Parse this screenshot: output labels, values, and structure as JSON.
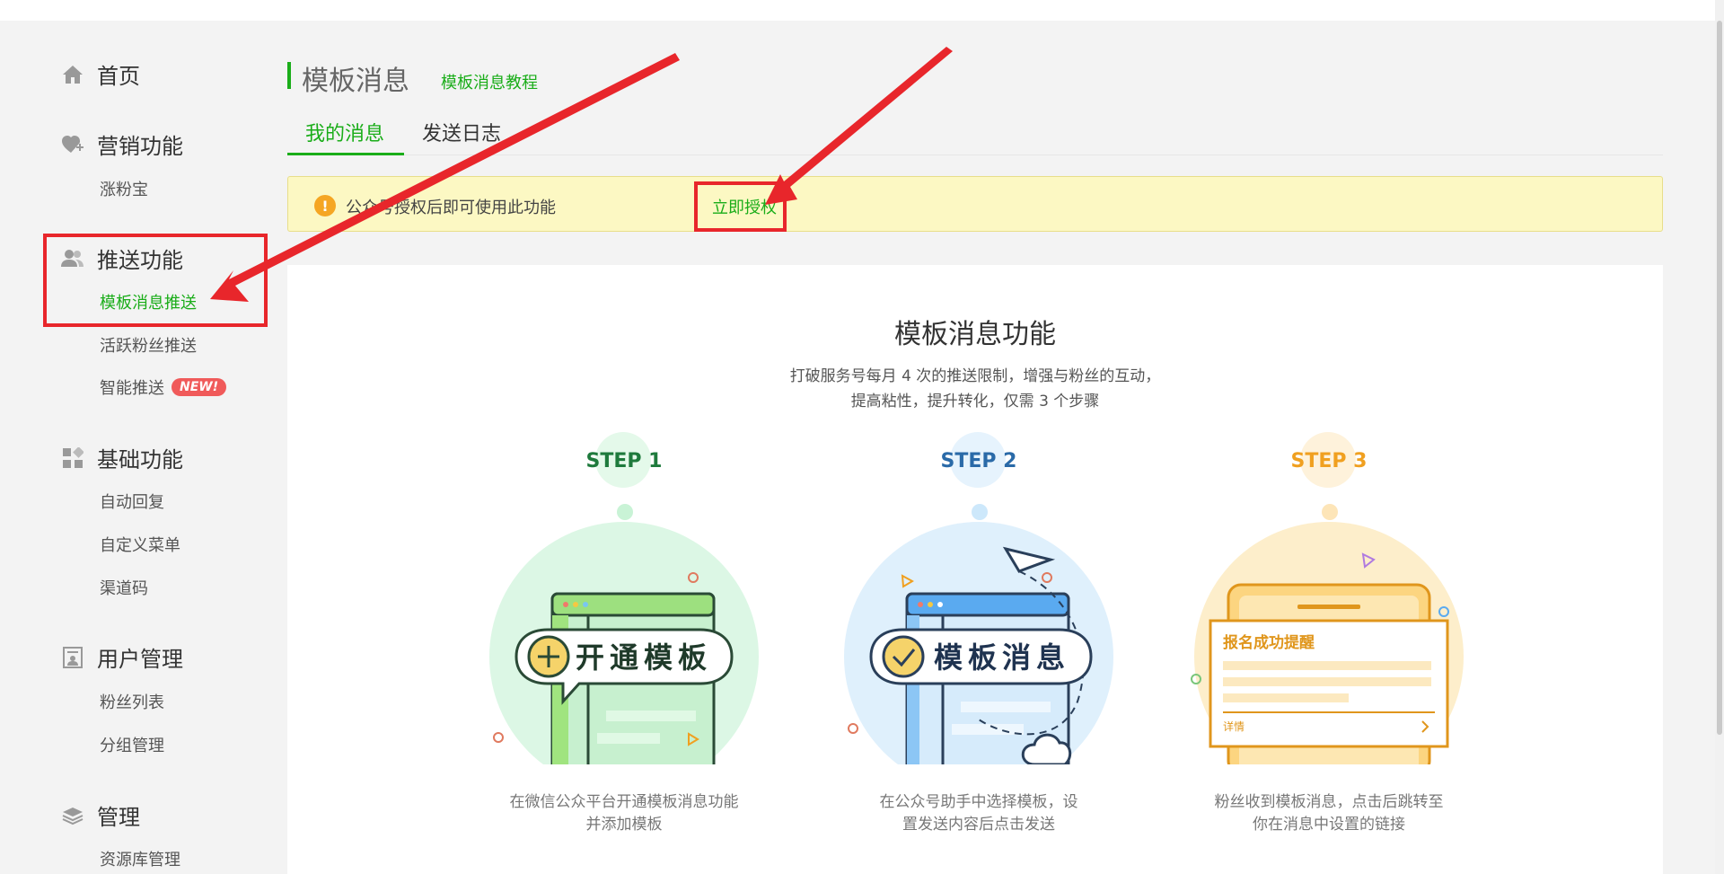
{
  "sidebar": {
    "home": "首页",
    "marketing": {
      "label": "营销功能",
      "items": [
        "涨粉宝"
      ]
    },
    "push": {
      "label": "推送功能",
      "items": [
        "模板消息推送",
        "活跃粉丝推送",
        "智能推送"
      ],
      "new_badge": "NEW!"
    },
    "basic": {
      "label": "基础功能",
      "items": [
        "自动回复",
        "自定义菜单",
        "渠道码"
      ]
    },
    "users": {
      "label": "用户管理",
      "items": [
        "粉丝列表",
        "分组管理"
      ]
    },
    "manage": {
      "label": "管理",
      "items": [
        "资源库管理"
      ]
    }
  },
  "main": {
    "title": "模板消息",
    "tutorial_link": "模板消息教程",
    "tabs": [
      "我的消息",
      "发送日志"
    ],
    "notice": {
      "text": "公众号授权后即可使用此功能",
      "action": "立即授权"
    },
    "feature": {
      "title": "模板消息功能",
      "desc_line1": "打破服务号每月 4 次的推送限制，增强与粉丝的互动，",
      "desc_line2": "提高粘性，提升转化，仅需 3 个步骤"
    },
    "steps": [
      {
        "label": "STEP 1",
        "art_text": "开通模板",
        "caption_line1": "在微信公众平台开通模板消息功能",
        "caption_line2": "并添加模板"
      },
      {
        "label": "STEP 2",
        "art_text": "模板消息",
        "caption_line1": "在公众号助手中选择模板，设",
        "caption_line2": "置发送内容后点击发送"
      },
      {
        "label": "STEP 3",
        "card_title": "报名成功提醒",
        "card_detail": "详情",
        "caption_line1": "粉丝收到模板消息，点击后跳转至",
        "caption_line2": "你在消息中设置的链接"
      }
    ]
  },
  "colors": {
    "accent": "#1aad19",
    "annotation": "#e8262b",
    "notice_bg": "#fcf8c3",
    "step1": "#1e7a3c",
    "step2": "#2a6aa8",
    "step3": "#f0a020"
  }
}
